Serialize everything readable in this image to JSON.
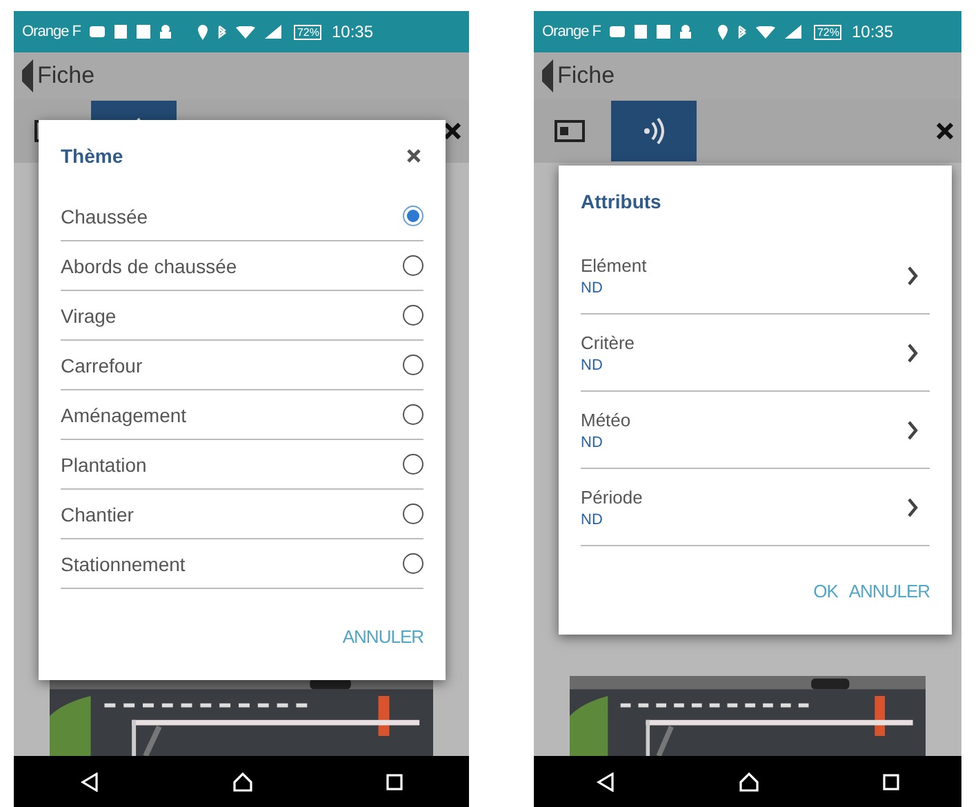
{
  "phones": [
    {
      "status_bar": {
        "carrier": "Orange F",
        "battery": "72%",
        "time": "10:35"
      },
      "header": {
        "title": "Fiche"
      },
      "tabs": [
        {
          "selected": false
        },
        {
          "selected": true
        }
      ],
      "dialog": {
        "kind": "radio",
        "title": "Thème",
        "options": [
          {
            "label": "Chaussée",
            "selected": true
          },
          {
            "label": "Abords de chaussée",
            "selected": false
          },
          {
            "label": "Virage",
            "selected": false
          },
          {
            "label": "Carrefour",
            "selected": false
          },
          {
            "label": "Aménagement",
            "selected": false
          },
          {
            "label": "Plantation",
            "selected": false
          },
          {
            "label": "Chantier",
            "selected": false
          },
          {
            "label": "Stationnement",
            "selected": false
          }
        ],
        "buttons": [
          "ANNULER"
        ]
      }
    },
    {
      "status_bar": {
        "carrier": "Orange F",
        "battery": "72%",
        "time": "10:35"
      },
      "header": {
        "title": "Fiche"
      },
      "tabs": [
        {
          "selected": false
        },
        {
          "selected": true
        }
      ],
      "dialog": {
        "kind": "attributes",
        "title": "Attributs",
        "fields": [
          {
            "label": "Elément",
            "value": "ND"
          },
          {
            "label": "Critère",
            "value": "ND"
          },
          {
            "label": "Météo",
            "value": "ND"
          },
          {
            "label": "Période",
            "value": "ND"
          }
        ],
        "buttons": [
          "OK",
          "ANNULER"
        ]
      }
    }
  ]
}
